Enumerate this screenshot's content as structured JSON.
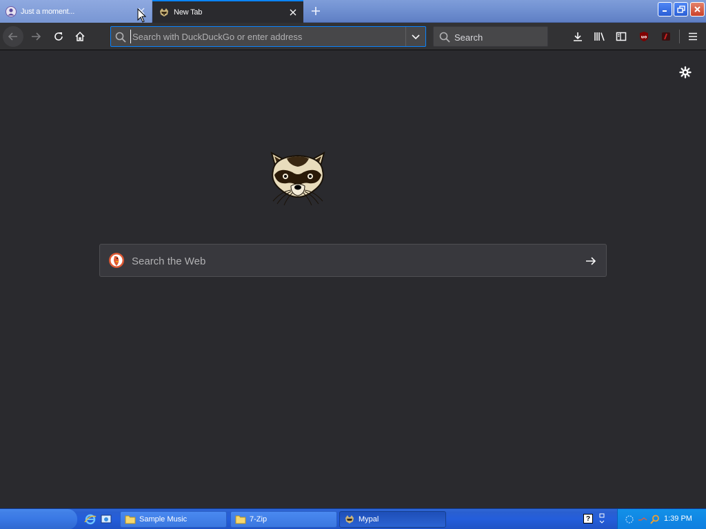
{
  "tabs": [
    {
      "label": "Just a moment...",
      "active": false
    },
    {
      "label": "New Tab",
      "active": true
    }
  ],
  "urlbar": {
    "placeholder": "Search with DuckDuckGo or enter address",
    "value": ""
  },
  "searchbar": {
    "placeholder": "Search"
  },
  "content": {
    "web_search_placeholder": "Search the Web"
  },
  "taskbar": {
    "tasks": [
      {
        "label": "Sample Music"
      },
      {
        "label": "7-Zip"
      },
      {
        "label": "Mypal"
      }
    ],
    "clock": "1:39 PM",
    "help_glyph": "?"
  },
  "colors": {
    "accent": "#0a84ff",
    "content_bg": "#2a2a2e",
    "toolbar_bg": "#323234",
    "ublock_red": "#800000"
  },
  "icons": [
    "back-arrow-icon",
    "forward-arrow-icon",
    "reload-icon",
    "home-icon",
    "search-icon",
    "chevron-down-icon",
    "download-icon",
    "library-icon",
    "sidebar-icon",
    "ublock-icon",
    "extension-icon",
    "hamburger-menu-icon",
    "gear-icon",
    "raccoon-logo",
    "duckduckgo-icon",
    "arrow-right-icon"
  ]
}
